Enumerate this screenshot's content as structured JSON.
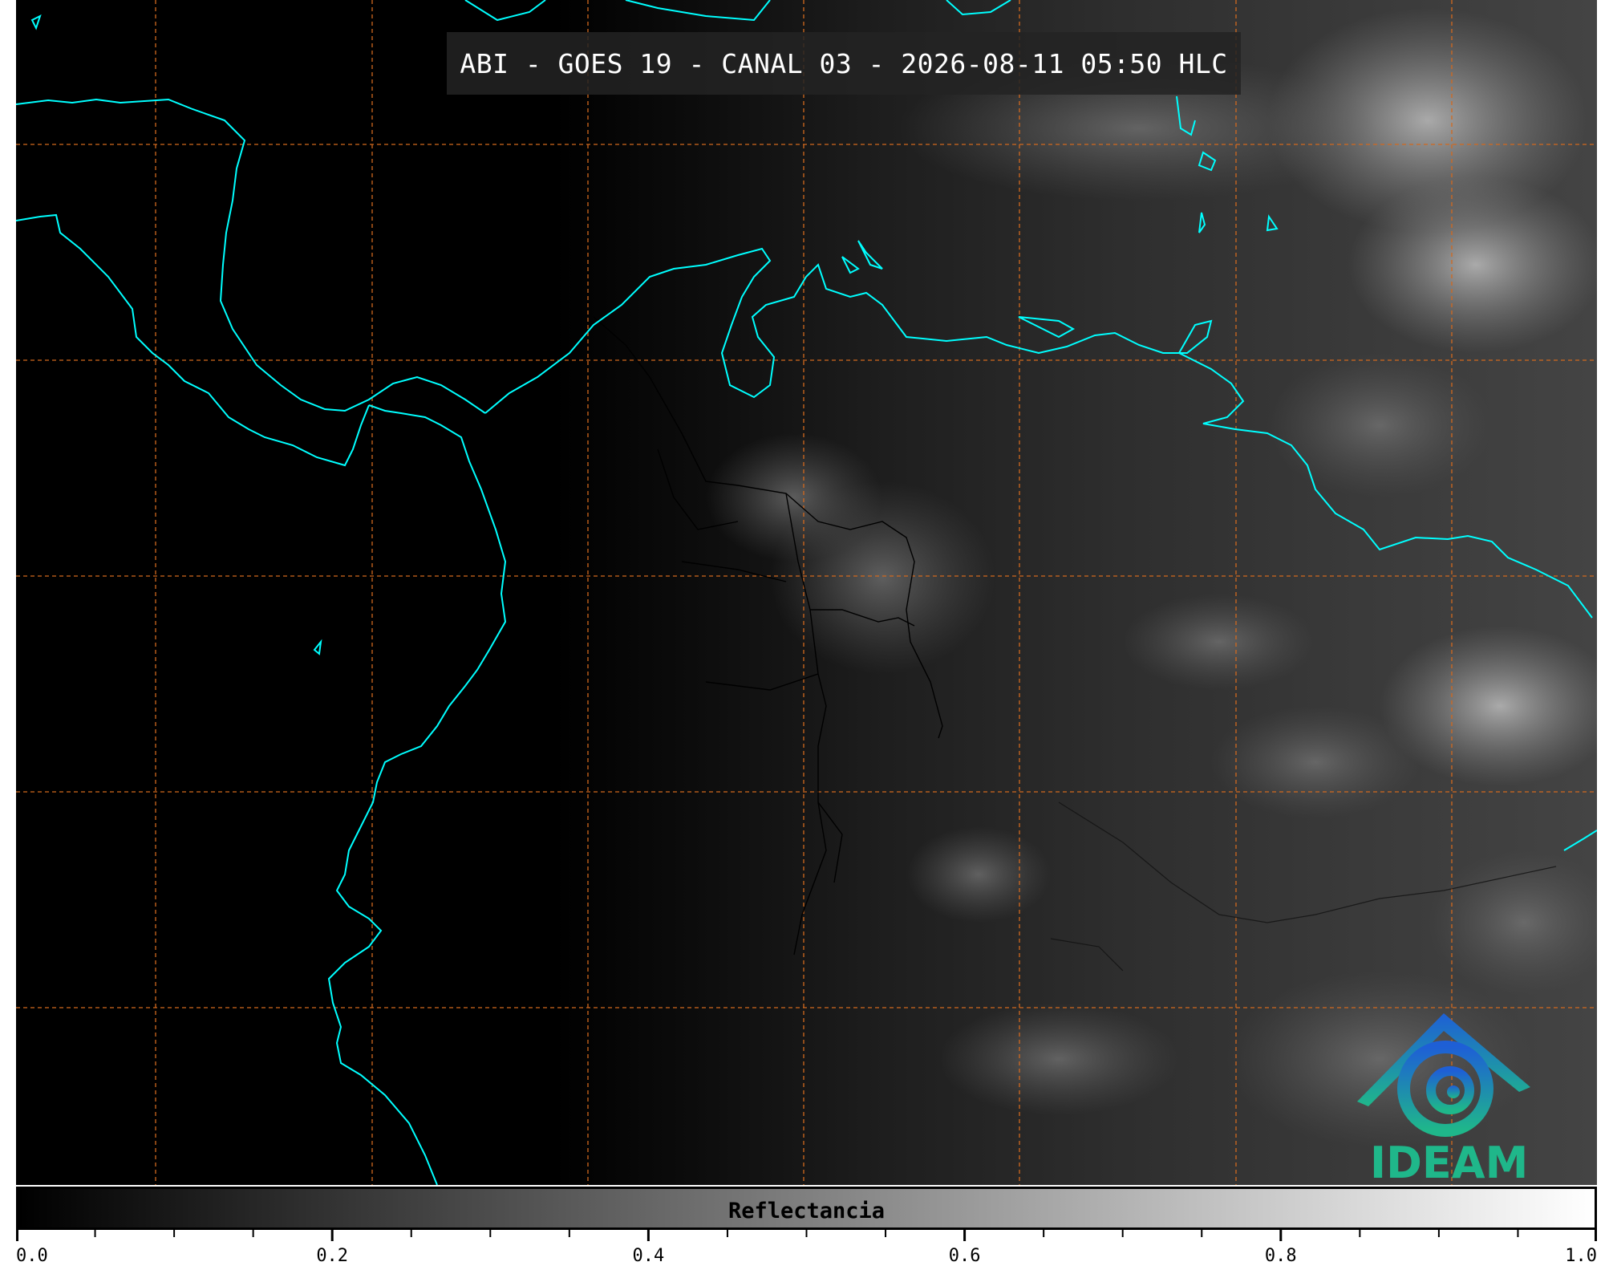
{
  "title": "ABI - GOES 19 - CANAL 03 - 2026-08-11 05:50 HLC",
  "logo": {
    "text": "IDEAM",
    "icon": "ideam-volcano-swirl-logo"
  },
  "colorbar": {
    "label": "Reflectancia",
    "min": 0.0,
    "max": 1.0,
    "ticks": [
      "0.0",
      "0.2",
      "0.4",
      "0.6",
      "0.8",
      "1.0"
    ],
    "minor_tick_step": 0.05,
    "start_color": "#000000",
    "end_color": "#ffffff"
  },
  "map": {
    "imagery": "grayscale visible reflectance, night on the west side",
    "coastline_color": "#00ffff",
    "border_color": "#000000",
    "graticule_color": "#d2691e",
    "graticule_style": "dashed"
  }
}
